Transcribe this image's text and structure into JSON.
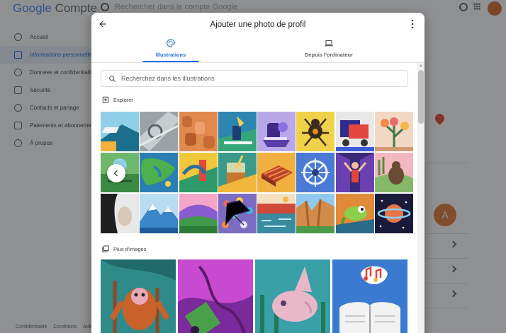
{
  "background": {
    "logo": {
      "word1": "Google",
      "word2": "Compte"
    },
    "search_placeholder": "Rechercher dans le compte Google",
    "nav": [
      {
        "label": "Accueil"
      },
      {
        "label": "Informations personnelles"
      },
      {
        "label": "Données et confidentialité"
      },
      {
        "label": "Sécurité"
      },
      {
        "label": "Contacts et partage"
      },
      {
        "label": "Paiements et abonnements"
      },
      {
        "label": "À propos"
      }
    ],
    "profile_initial": "A",
    "footer": [
      "Confidentialité",
      "Conditions",
      "Aide"
    ]
  },
  "dialog": {
    "title": "Ajouter une photo de profil",
    "tabs": [
      {
        "label": "Illustrations",
        "icon": "palette-icon",
        "active": true
      },
      {
        "label": "Depuis l'ordinateur",
        "icon": "laptop-icon",
        "active": false
      }
    ],
    "search_placeholder": "Recherchez dans les illustrations",
    "explore_label": "Explorer",
    "more_images_label": "Plus d'images"
  },
  "colors": {
    "accent": "#1a73e8",
    "scrim": "rgba(32,33,36,0.5)"
  }
}
